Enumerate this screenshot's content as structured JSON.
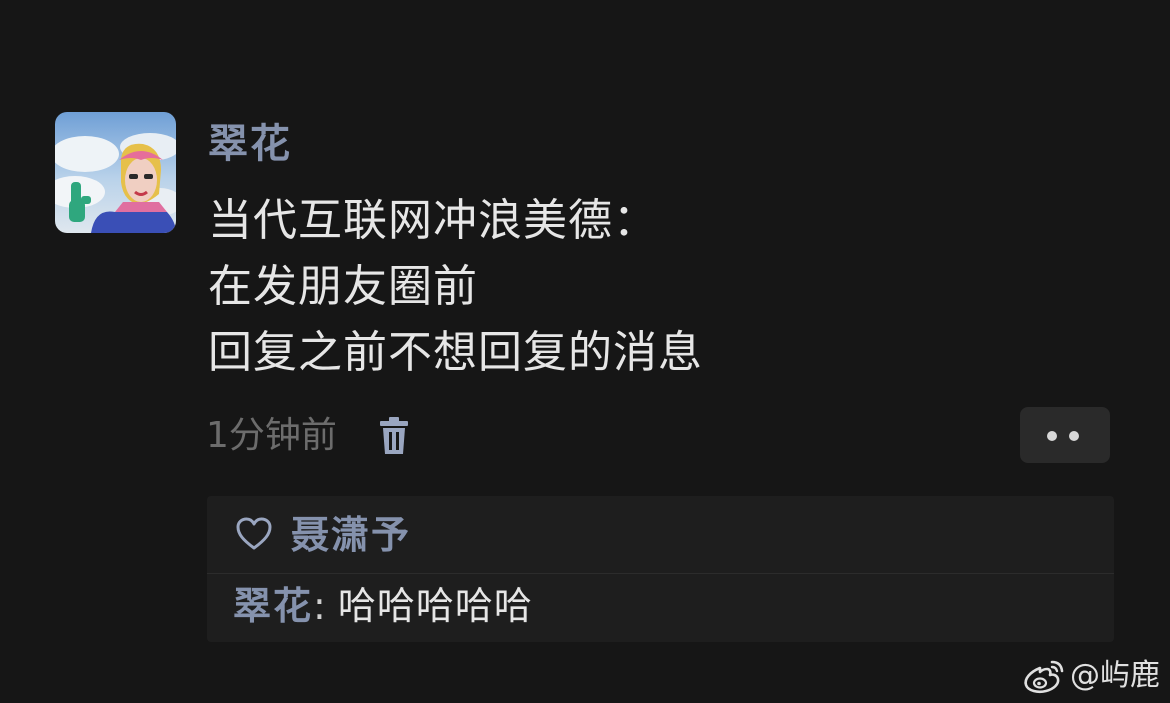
{
  "post": {
    "author": "翠花",
    "text_lines": [
      "当代互联网冲浪美德：",
      "在发朋友圈前",
      "回复之前不想回复的消息"
    ],
    "timestamp": "1分钟前"
  },
  "likes": {
    "names": "聂潇予"
  },
  "comments": [
    {
      "author": "翠花",
      "colon": ": ",
      "text": "哈哈哈哈哈"
    }
  ],
  "watermark": {
    "handle": "@屿鹿"
  },
  "colors": {
    "background": "#161616",
    "name_accent": "#8592ad",
    "panel_background": "#1e1e1e",
    "secondary_text": "#6c6c6c",
    "primary_text": "#e6e6e6"
  },
  "icons": {
    "delete": "trash-icon",
    "more": "more-dots-icon",
    "like": "heart-outline-icon",
    "watermark": "weibo-logo-icon"
  }
}
